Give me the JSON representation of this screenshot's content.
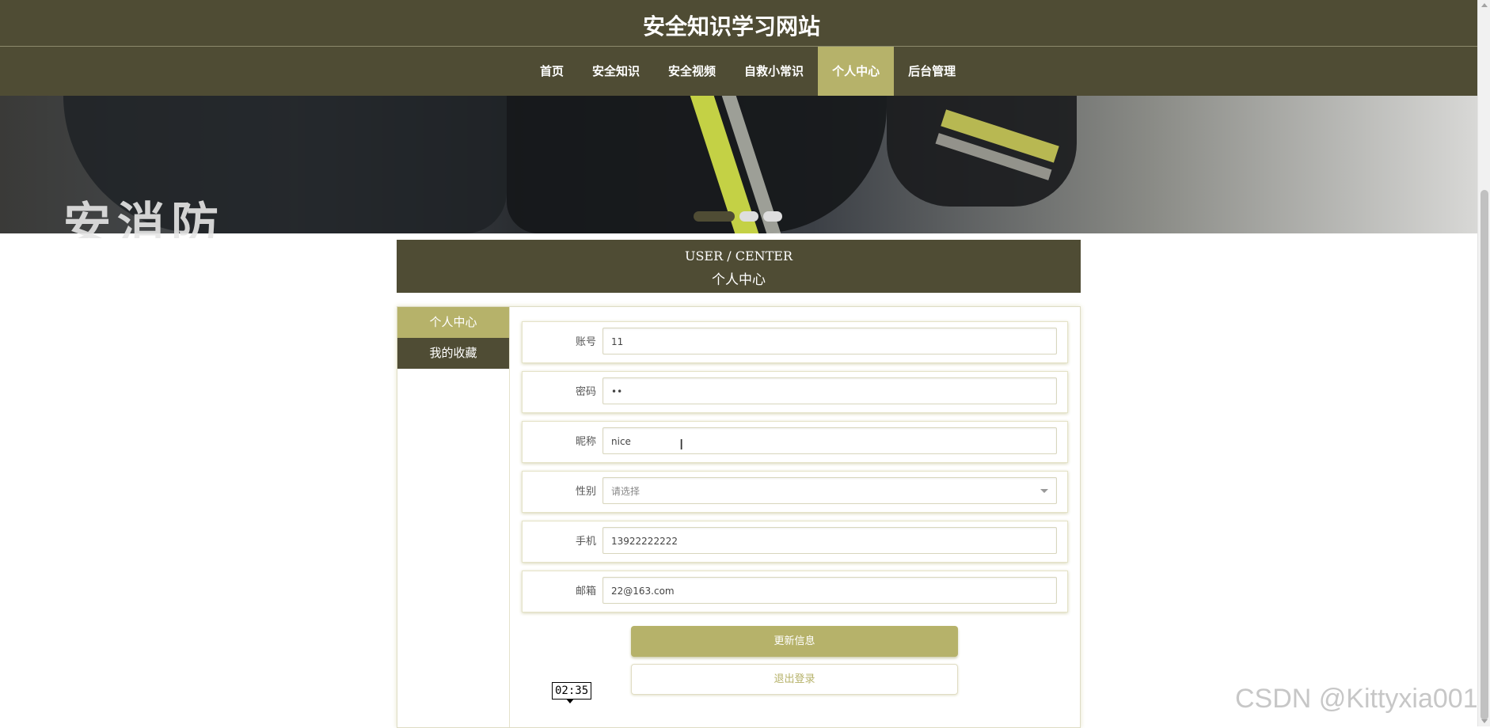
{
  "site": {
    "title": "安全知识学习网站"
  },
  "nav": {
    "items": [
      {
        "label": "首页"
      },
      {
        "label": "安全知识"
      },
      {
        "label": "安全视频"
      },
      {
        "label": "自救小常识"
      },
      {
        "label": "个人中心",
        "active": true
      },
      {
        "label": "后台管理"
      }
    ]
  },
  "banner": {
    "overlay_text": "安消防",
    "slides_total": 3,
    "active_slide": 1
  },
  "user_center": {
    "title_en": "USER / CENTER",
    "title_cn": "个人中心"
  },
  "side_menu": {
    "items": [
      {
        "label": "个人中心",
        "active": true
      },
      {
        "label": "我的收藏",
        "active": false
      }
    ]
  },
  "form": {
    "account_label": "账号",
    "account_value": "11",
    "password_label": "密码",
    "password_value": "••",
    "nickname_label": "昵称",
    "nickname_value": "nice",
    "gender_label": "性别",
    "gender_placeholder": "请选择",
    "phone_label": "手机",
    "phone_value": "13922222222",
    "email_label": "邮箱",
    "email_value": "22@163.com",
    "update_button": "更新信息",
    "logout_button": "退出登录"
  },
  "tooltip": {
    "time": "02:35"
  },
  "watermark": "CSDN @Kittyxia001",
  "colors": {
    "primary_dark": "#4f4c34",
    "accent": "#b6b26a"
  }
}
